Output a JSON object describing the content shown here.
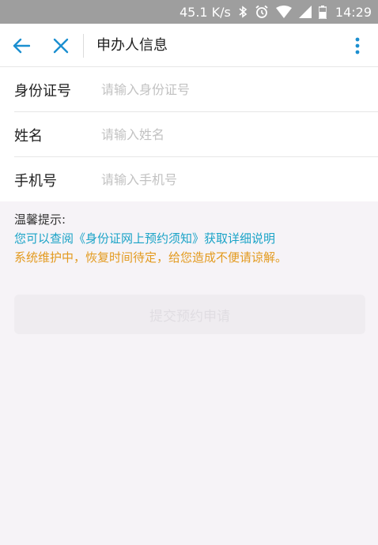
{
  "status_bar": {
    "speed": "45.1 K/s",
    "time": "14:29",
    "icons": [
      "bluetooth-icon",
      "alarm-icon",
      "wifi-icon",
      "signal-icon",
      "battery-icon"
    ]
  },
  "app_bar": {
    "title": "申办人信息",
    "icons": [
      "back-arrow-icon",
      "close-icon",
      "more-vertical-icon"
    ],
    "accent": "#1b8fd0"
  },
  "form": {
    "fields": [
      {
        "label": "身份证号",
        "placeholder": "请输入身份证号",
        "value": ""
      },
      {
        "label": "姓名",
        "placeholder": "请输入姓名",
        "value": ""
      },
      {
        "label": "手机号",
        "placeholder": "请输入手机号",
        "value": ""
      }
    ]
  },
  "tips": {
    "title": "温馨提示:",
    "link_text": "您可以查阅《身份证网上预约须知》获取详细说明",
    "warning": "系统维护中，恢复时间待定，给您造成不便请谅解。",
    "link_color": "#1aa3c7",
    "warning_color": "#e39a1e"
  },
  "submit": {
    "label": "提交预约申请"
  }
}
